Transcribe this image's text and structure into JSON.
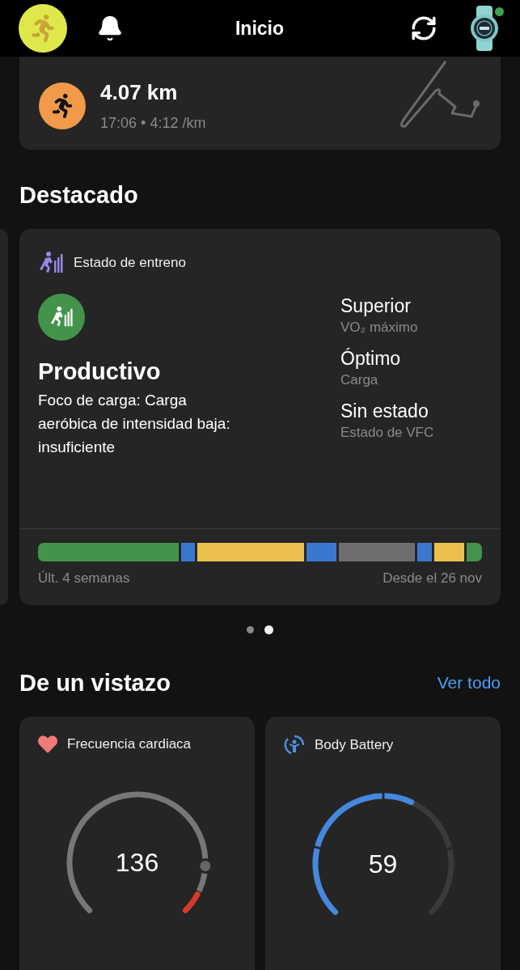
{
  "header": {
    "title": "Inicio",
    "watch_connected": true
  },
  "activity": {
    "distance": "4.07 km",
    "time": "17:06",
    "separator": "•",
    "pace": "4:12 /km"
  },
  "featured": {
    "title": "Destacado",
    "card": {
      "title": "Estado de entreno",
      "status": "Productivo",
      "description": "Foco de carga: Carga aeróbica de intensidad baja: insuficiente",
      "metrics": [
        {
          "value": "Superior",
          "label": "VO₂ máximo"
        },
        {
          "value": "Óptimo",
          "label": "Carga"
        },
        {
          "value": "Sin estado",
          "label": "Estado de VFC"
        }
      ],
      "history": [
        {
          "color": "#43944a"
        },
        {
          "color": "#3a78d0"
        },
        {
          "color": "#ecc04e"
        },
        {
          "color": "#3a78d0"
        },
        {
          "color": "#6f6f6f"
        },
        {
          "color": "#3a78d0"
        },
        {
          "color": "#ecc04e"
        },
        {
          "color": "#43944a"
        }
      ],
      "range_start": "Últ. 4 semanas",
      "range_end": "Desde el 26 nov"
    },
    "pages": [
      {
        "selected": false
      },
      {
        "selected": true
      }
    ]
  },
  "glance": {
    "title": "De un vistazo",
    "link": "Ver todo",
    "cards": [
      {
        "kind": "heart",
        "title": "Frecuencia cardiaca",
        "value": "136"
      },
      {
        "kind": "battery",
        "title": "Body Battery",
        "value": "59"
      }
    ]
  }
}
